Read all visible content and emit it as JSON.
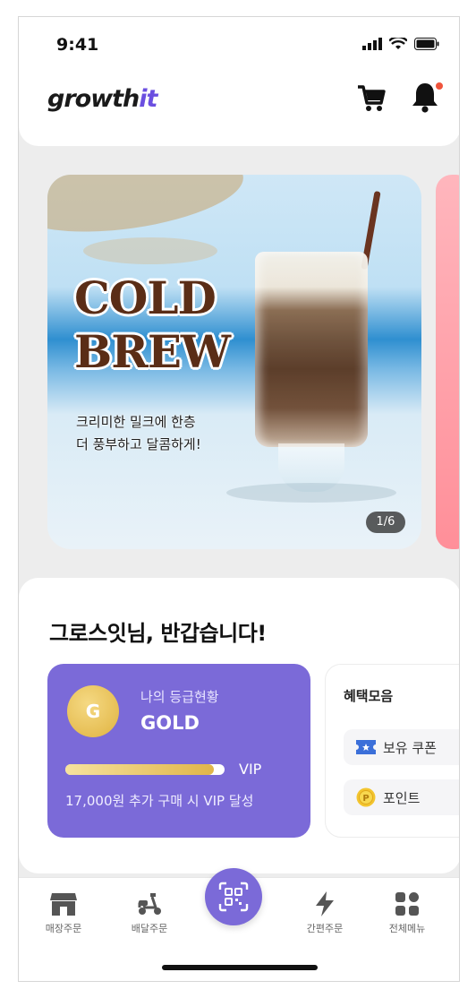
{
  "status_bar": {
    "time": "9:41"
  },
  "header": {
    "logo_main": "growth",
    "logo_accent": "it",
    "notification_dot_color": "#f0543c"
  },
  "banner": {
    "title_line1": "COLD",
    "title_line2": "BREW",
    "subtitle_line1": "크리미한 밀크에 한층",
    "subtitle_line2": "더 풍부하고 달콤하게!",
    "counter": "1/6"
  },
  "member": {
    "greeting": "그로스잇님, 반갑습니다!",
    "grade": {
      "badge_letter": "G",
      "label": "나의 등급현황",
      "name": "GOLD",
      "next_grade": "VIP",
      "progress": 0.93,
      "note": "17,000원 추가 구매 시 VIP 달성"
    },
    "benefits": {
      "title": "혜택모음",
      "coupon_label": "보유 쿠폰",
      "point_label": "포인트"
    }
  },
  "tabbar": {
    "store_order": "매장주문",
    "delivery_order": "배달주문",
    "quick_order": "간편주문",
    "all_menu": "전체메뉴"
  },
  "colors": {
    "accent": "#7b6ad8",
    "gold": "#e0b340"
  }
}
